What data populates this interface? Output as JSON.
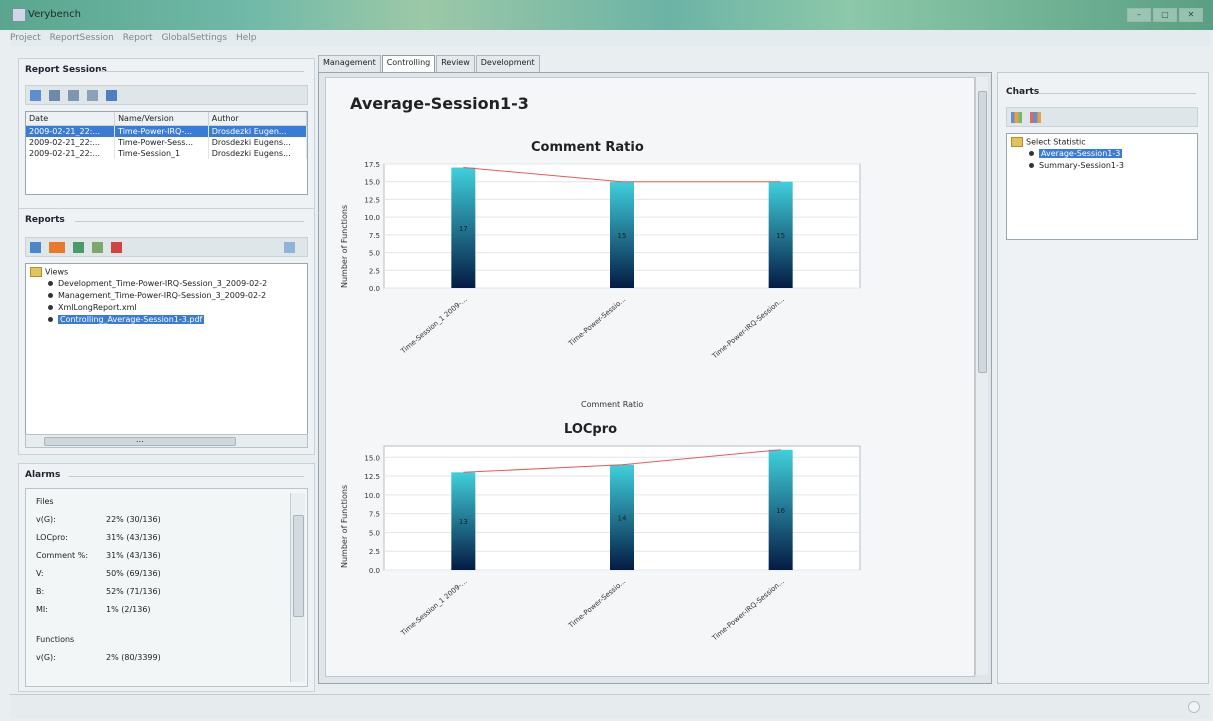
{
  "window": {
    "title": "Verybench",
    "buttons": [
      "–",
      "▢",
      "✕"
    ]
  },
  "menu": [
    "Project",
    "ReportSession",
    "Report",
    "GlobalSettings",
    "Help"
  ],
  "report_sessions": {
    "title": "Report Sessions",
    "columns": [
      "Date",
      "Name/Version",
      "Author"
    ],
    "rows": [
      {
        "date": "2009-02-21_22:...",
        "name": "Time-Power-IRQ-...",
        "author": "Drosdezki Eugen..."
      },
      {
        "date": "2009-02-21_22:...",
        "name": "Time-Power-Sess...",
        "author": "Drosdezki Eugens..."
      },
      {
        "date": "2009-02-21_22:...",
        "name": "Time-Session_1",
        "author": "Drosdezki Eugens..."
      }
    ]
  },
  "reports": {
    "title": "Reports",
    "root": "Views",
    "items": [
      "Development_Time-Power-IRQ-Session_3_2009-02-2",
      "Management_Time-Power-IRQ-Session_3_2009-02-2",
      "XmlLongReport.xml",
      "Controlling_Average-Session1-3.pdf"
    ],
    "scroll_label": "..."
  },
  "alarms": {
    "title": "Alarms",
    "files_heading": "Files",
    "files": [
      {
        "label": "v(G):",
        "value": "22% (30/136)"
      },
      {
        "label": "LOCpro:",
        "value": "31% (43/136)"
      },
      {
        "label": "Comment %:",
        "value": "31% (43/136)"
      },
      {
        "label": "V:",
        "value": "50% (69/136)"
      },
      {
        "label": "B:",
        "value": "52% (71/136)"
      },
      {
        "label": "MI:",
        "value": "1% (2/136)"
      }
    ],
    "functions_heading": "Functions",
    "functions": [
      {
        "label": "v(G):",
        "value": "2% (80/3399)"
      }
    ]
  },
  "tabs": [
    "Management",
    "Controlling",
    "Review",
    "Development"
  ],
  "active_tab": "Controlling",
  "main": {
    "heading": "Average-Session1-3"
  },
  "chart_data": [
    {
      "type": "bar",
      "title": "Comment Ratio",
      "xlabel": "Comment Ratio",
      "ylabel": "Number of Functions",
      "categories": [
        "Time-Session_1 2009-...",
        "Time-Power-Sessio...",
        "Time-Power-IRQ-Session..."
      ],
      "values": [
        17,
        15,
        15
      ],
      "data_labels": [
        "17",
        "15",
        "15"
      ],
      "ylim": [
        0,
        17.5
      ],
      "yticks": [
        "0.0",
        "2.5",
        "5.0",
        "7.5",
        "10.0",
        "12.5",
        "15.0",
        "17.5"
      ],
      "trend_line": true
    },
    {
      "type": "bar",
      "title": "LOCpro",
      "xlabel": "",
      "ylabel": "Number of Functions",
      "categories": [
        "Time-Session_1 2009-...",
        "Time-Power-Sessio...",
        "Time-Power-IRQ-Session..."
      ],
      "values": [
        13,
        14,
        16
      ],
      "data_labels": [
        "13",
        "14",
        "16"
      ],
      "ylim": [
        0,
        16.5
      ],
      "yticks": [
        "0.0",
        "2.5",
        "5.0",
        "7.5",
        "10.0",
        "12.5",
        "15.0"
      ],
      "trend_line": true
    }
  ],
  "charts_panel": {
    "title": "Charts",
    "root": "Select Statistic",
    "items": [
      "Average-Session1-3",
      "Summary-Session1-3"
    ]
  },
  "colors": {
    "selection": "#3a7bd5",
    "bar_top": "#3fd0dc",
    "bar_bottom": "#041b44",
    "trend": "#e85a5a"
  }
}
